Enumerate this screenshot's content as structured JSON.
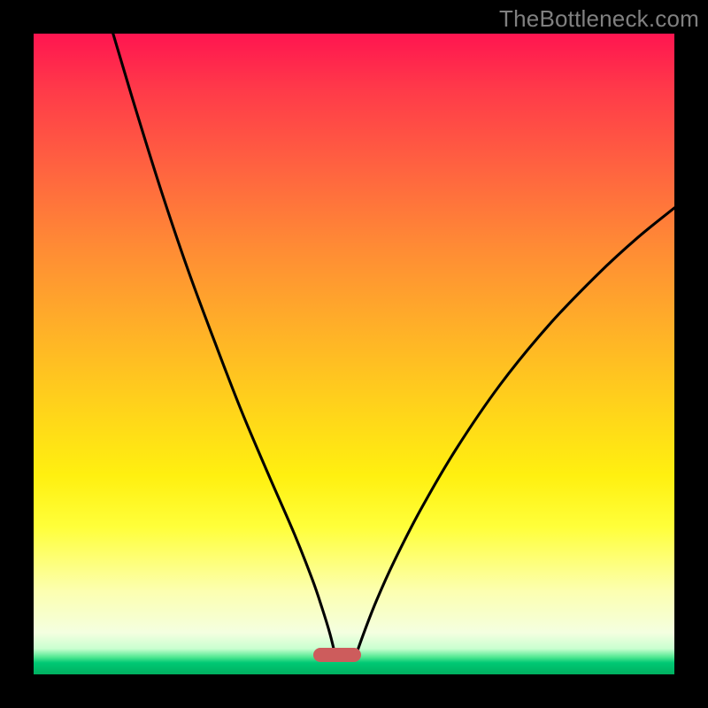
{
  "watermark": "TheBottleneck.com",
  "colors": {
    "bg": "#000000",
    "gradient_top": "#ff1550",
    "gradient_bottom": "#00b060",
    "curve": "#000000",
    "marker": "#cd5c5c",
    "watermark": "#808080"
  },
  "chart_data": {
    "type": "line",
    "title": "",
    "xlabel": "",
    "ylabel": "",
    "xlim": [
      0,
      100
    ],
    "ylim": [
      0,
      100
    ],
    "optimal_marker": {
      "x_start": 43.6,
      "x_end": 51.1,
      "y": 2.8
    },
    "series": [
      {
        "name": "left",
        "x": [
          12.4,
          15.9,
          20,
          24.1,
          28.3,
          32.4,
          36.6,
          40.7,
          43.5,
          45,
          46.2,
          47
        ],
        "y": [
          100,
          88.3,
          75.2,
          63.1,
          51.8,
          41.2,
          31.3,
          21.9,
          14.8,
          10.4,
          6.5,
          3.3
        ]
      },
      {
        "name": "right",
        "x": [
          50.4,
          51.7,
          53.5,
          56.2,
          60.4,
          65.9,
          72.8,
          80.4,
          88,
          94.2,
          100
        ],
        "y": [
          3.3,
          6.9,
          11.5,
          17.5,
          25.7,
          35.1,
          45.2,
          54.5,
          62.4,
          68.1,
          72.8
        ]
      }
    ]
  }
}
